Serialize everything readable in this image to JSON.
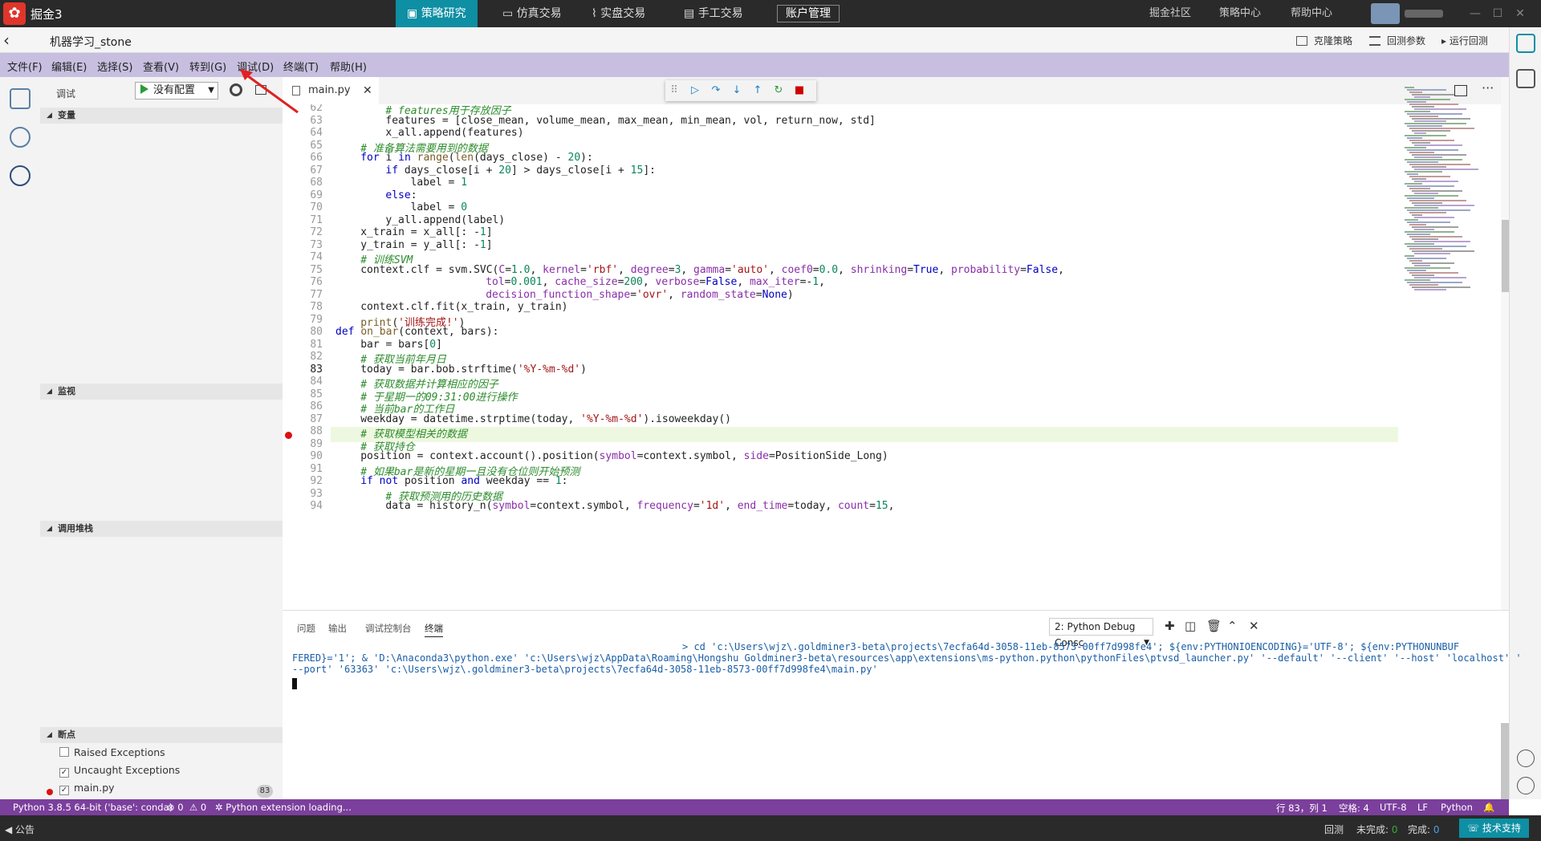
{
  "topbar": {
    "app_name": "掘金3",
    "tabs": [
      "策略研究",
      "仿真交易",
      "实盘交易",
      "手工交易"
    ],
    "account": "账户管理",
    "links": [
      "掘金社区",
      "策略中心",
      "帮助中心"
    ]
  },
  "bar2": {
    "title": "机器学习_stone",
    "clone": "克隆策略",
    "params": "回测参数",
    "run": "运行回测"
  },
  "menubar": [
    "文件(F)",
    "编辑(E)",
    "选择(S)",
    "查看(V)",
    "转到(G)",
    "调试(D)",
    "终端(T)",
    "帮助(H)"
  ],
  "sidebar": {
    "debug_label": "调试",
    "config": "没有配置",
    "sections": {
      "variables": "变量",
      "watch": "监视",
      "callstack": "调用堆栈",
      "breakpoints": "断点"
    },
    "breakpoints": [
      {
        "label": "Raised Exceptions",
        "checked": false
      },
      {
        "label": "Uncaught Exceptions",
        "checked": true
      },
      {
        "label": "main.py",
        "checked": true
      }
    ],
    "bp_count": "83"
  },
  "editor": {
    "tab": "main.py",
    "highlight_line": 83,
    "lines": [
      {
        "n": "62",
        "i": 2,
        "segs": [
          [
            "cm",
            "# features用于存放因子"
          ]
        ]
      },
      {
        "n": "63",
        "i": 2,
        "segs": [
          [
            "",
            "features = [close_mean, volume_mean, max_mean, min_mean, vol, return_now, std]"
          ]
        ]
      },
      {
        "n": "64",
        "i": 2,
        "segs": [
          [
            "",
            "x_all.append(features)"
          ]
        ]
      },
      {
        "n": "65",
        "i": 1,
        "segs": [
          [
            "cm",
            "# 准备算法需要用到的数据"
          ]
        ]
      },
      {
        "n": "66",
        "i": 1,
        "segs": [
          [
            "kw",
            "for"
          ],
          [
            "",
            " i "
          ],
          [
            "kw",
            "in"
          ],
          [
            "",
            " "
          ],
          [
            "fn",
            "range"
          ],
          [
            "",
            "("
          ],
          [
            "fn",
            "len"
          ],
          [
            "",
            "(days_close) - "
          ],
          [
            "nu",
            "20"
          ],
          [
            "",
            "):"
          ]
        ]
      },
      {
        "n": "67",
        "i": 2,
        "segs": [
          [
            "kw",
            "if"
          ],
          [
            "",
            " days_close[i + "
          ],
          [
            "nu",
            "20"
          ],
          [
            "",
            "] > days_close[i + "
          ],
          [
            "nu",
            "15"
          ],
          [
            "",
            "]:"
          ]
        ]
      },
      {
        "n": "68",
        "i": 3,
        "segs": [
          [
            "",
            "label = "
          ],
          [
            "nu",
            "1"
          ]
        ]
      },
      {
        "n": "69",
        "i": 2,
        "segs": [
          [
            "kw",
            "else"
          ],
          [
            "",
            ":"
          ]
        ]
      },
      {
        "n": "70",
        "i": 3,
        "segs": [
          [
            "",
            "label = "
          ],
          [
            "nu",
            "0"
          ]
        ]
      },
      {
        "n": "71",
        "i": 2,
        "segs": [
          [
            "",
            "y_all.append(label)"
          ]
        ]
      },
      {
        "n": "72",
        "i": 1,
        "segs": [
          [
            "",
            "x_train = x_all[: -"
          ],
          [
            "nu",
            "1"
          ],
          [
            "",
            "]"
          ]
        ]
      },
      {
        "n": "73",
        "i": 1,
        "segs": [
          [
            "",
            "y_train = y_all[: -"
          ],
          [
            "nu",
            "1"
          ],
          [
            "",
            "]"
          ]
        ]
      },
      {
        "n": "74",
        "i": 1,
        "segs": [
          [
            "cm",
            "# 训练SVM"
          ]
        ]
      },
      {
        "n": "75",
        "i": 1,
        "segs": [
          [
            "",
            "context.clf = svm.SVC("
          ],
          [
            "pa",
            "C"
          ],
          [
            "",
            "="
          ],
          [
            "nu",
            "1.0"
          ],
          [
            "",
            ", "
          ],
          [
            "pa",
            "kernel"
          ],
          [
            "",
            "="
          ],
          [
            "st",
            "'rbf'"
          ],
          [
            "",
            ", "
          ],
          [
            "pa",
            "degree"
          ],
          [
            "",
            "="
          ],
          [
            "nu",
            "3"
          ],
          [
            "",
            ", "
          ],
          [
            "pa",
            "gamma"
          ],
          [
            "",
            "="
          ],
          [
            "st",
            "'auto'"
          ],
          [
            "",
            ", "
          ],
          [
            "pa",
            "coef0"
          ],
          [
            "",
            "="
          ],
          [
            "nu",
            "0.0"
          ],
          [
            "",
            ", "
          ],
          [
            "pa",
            "shrinking"
          ],
          [
            "",
            "="
          ],
          [
            "kw",
            "True"
          ],
          [
            "",
            ", "
          ],
          [
            "pa",
            "probability"
          ],
          [
            "",
            "="
          ],
          [
            "kw",
            "False"
          ],
          [
            "",
            ","
          ]
        ]
      },
      {
        "n": "76",
        "i": 6,
        "segs": [
          [
            "pa",
            "tol"
          ],
          [
            "",
            "="
          ],
          [
            "nu",
            "0.001"
          ],
          [
            "",
            ", "
          ],
          [
            "pa",
            "cache_size"
          ],
          [
            "",
            "="
          ],
          [
            "nu",
            "200"
          ],
          [
            "",
            ", "
          ],
          [
            "pa",
            "verbose"
          ],
          [
            "",
            "="
          ],
          [
            "kw",
            "False"
          ],
          [
            "",
            ", "
          ],
          [
            "pa",
            "max_iter"
          ],
          [
            "",
            "=-"
          ],
          [
            "nu",
            "1"
          ],
          [
            "",
            ","
          ]
        ]
      },
      {
        "n": "77",
        "i": 6,
        "segs": [
          [
            "pa",
            "decision_function_shape"
          ],
          [
            "",
            "="
          ],
          [
            "st",
            "'ovr'"
          ],
          [
            "",
            ", "
          ],
          [
            "pa",
            "random_state"
          ],
          [
            "",
            "="
          ],
          [
            "kw",
            "None"
          ],
          [
            "",
            ")"
          ]
        ]
      },
      {
        "n": "78",
        "i": 1,
        "segs": [
          [
            "",
            "context.clf.fit(x_train, y_train)"
          ]
        ]
      },
      {
        "n": "79",
        "i": 1,
        "segs": [
          [
            "fn",
            "print"
          ],
          [
            "",
            "("
          ],
          [
            "st",
            "'训练完成!'"
          ],
          [
            "",
            ")"
          ]
        ]
      },
      {
        "n": "80",
        "i": 0,
        "segs": [
          [
            "kw",
            "def"
          ],
          [
            "",
            " "
          ],
          [
            "fn",
            "on_bar"
          ],
          [
            "",
            "(context, bars):"
          ]
        ]
      },
      {
        "n": "81",
        "i": 1,
        "segs": [
          [
            "",
            "bar = bars["
          ],
          [
            "nu",
            "0"
          ],
          [
            "",
            "]"
          ]
        ]
      },
      {
        "n": "82",
        "i": 1,
        "segs": [
          [
            "cm",
            "# 获取当前年月日"
          ]
        ]
      },
      {
        "n": "83",
        "i": 1,
        "segs": [
          [
            "",
            "today = bar.bob.strftime("
          ],
          [
            "st",
            "'%Y-%m-%d'"
          ],
          [
            "",
            ")"
          ]
        ]
      },
      {
        "n": "84",
        "i": 1,
        "segs": [
          [
            "cm",
            "# 获取数据并计算相应的因子"
          ]
        ]
      },
      {
        "n": "85",
        "i": 1,
        "segs": [
          [
            "cm",
            "# 于星期一的09:31:00进行操作"
          ]
        ]
      },
      {
        "n": "86",
        "i": 1,
        "segs": [
          [
            "cm",
            "# 当前bar的工作日"
          ]
        ]
      },
      {
        "n": "87",
        "i": 1,
        "segs": [
          [
            "",
            "weekday = datetime.strptime(today, "
          ],
          [
            "st",
            "'%Y-%m-%d'"
          ],
          [
            "",
            ").isoweekday()"
          ]
        ]
      },
      {
        "n": "88",
        "i": 1,
        "segs": [
          [
            "cm",
            "# 获取模型相关的数据"
          ]
        ]
      },
      {
        "n": "89",
        "i": 1,
        "segs": [
          [
            "cm",
            "# 获取持仓"
          ]
        ]
      },
      {
        "n": "90",
        "i": 1,
        "segs": [
          [
            "",
            "position = context.account().position("
          ],
          [
            "pa",
            "symbol"
          ],
          [
            "",
            "=context.symbol, "
          ],
          [
            "pa",
            "side"
          ],
          [
            "",
            "=PositionSide_Long)"
          ]
        ]
      },
      {
        "n": "91",
        "i": 1,
        "segs": [
          [
            "cm",
            "# 如果bar是新的星期一且没有仓位则开始预测"
          ]
        ]
      },
      {
        "n": "92",
        "i": 1,
        "segs": [
          [
            "kw",
            "if not"
          ],
          [
            "",
            " position "
          ],
          [
            "kw",
            "and"
          ],
          [
            "",
            " weekday == "
          ],
          [
            "nu",
            "1"
          ],
          [
            "",
            ":"
          ]
        ]
      },
      {
        "n": "93",
        "i": 2,
        "segs": [
          [
            "cm",
            "# 获取预测用的历史数据"
          ]
        ]
      },
      {
        "n": "94",
        "i": 2,
        "segs": [
          [
            "",
            "data = history_n("
          ],
          [
            "pa",
            "symbol"
          ],
          [
            "",
            "=context.symbol, "
          ],
          [
            "pa",
            "frequency"
          ],
          [
            "",
            "="
          ],
          [
            "st",
            "'1d'"
          ],
          [
            "",
            ", "
          ],
          [
            "pa",
            "end_time"
          ],
          [
            "",
            "=today, "
          ],
          [
            "pa",
            "count"
          ],
          [
            "",
            "="
          ],
          [
            "nu",
            "15"
          ],
          [
            "",
            ","
          ]
        ]
      }
    ]
  },
  "panel": {
    "tabs": [
      "问题",
      "输出",
      "调试控制台",
      "终端"
    ],
    "active_tab": "终端",
    "terminal_select": "2: Python Debug Consc",
    "term_line1": "> cd 'c:\\Users\\wjz\\.goldminer3-beta\\projects\\7ecfa64d-3058-11eb-8573-00ff7d998fe4'; ${env:PYTHONIOENCODING}='UTF-8'; ${env:PYTHONUNBUF",
    "term_line2": "FERED}='1'; & 'D:\\Anaconda3\\python.exe' 'c:\\Users\\wjz\\AppData\\Roaming\\Hongshu Goldminer3-beta\\resources\\app\\extensions\\ms-python.python\\pythonFiles\\ptvsd_launcher.py' '--default' '--client' '--host' 'localhost' '",
    "term_line3": "--port' '63363' 'c:\\Users\\wjz\\.goldminer3-beta\\projects\\7ecfa64d-3058-11eb-8573-00ff7d998fe4\\main.py'"
  },
  "status": {
    "python": "Python 3.8.5 64-bit ('base': conda)",
    "problems": "⊗ 0  ⚠ 0",
    "loading": "Python extension loading...",
    "position": "行 83，列 1",
    "spaces": "空格: 4",
    "encoding": "UTF-8",
    "eol": "LF",
    "language": "Python"
  },
  "bottombar": {
    "notice": "公告",
    "backtest": "回测",
    "unfinished_label": "未完成:",
    "unfinished": "0",
    "finished_label": "完成:",
    "finished": "0",
    "support": "技术支持"
  },
  "colors": {
    "accent": "#0e8fa3",
    "menubar": "#c8bfe0",
    "statusbar": "#7b3f9c",
    "breakpoint": "#dd1111"
  }
}
